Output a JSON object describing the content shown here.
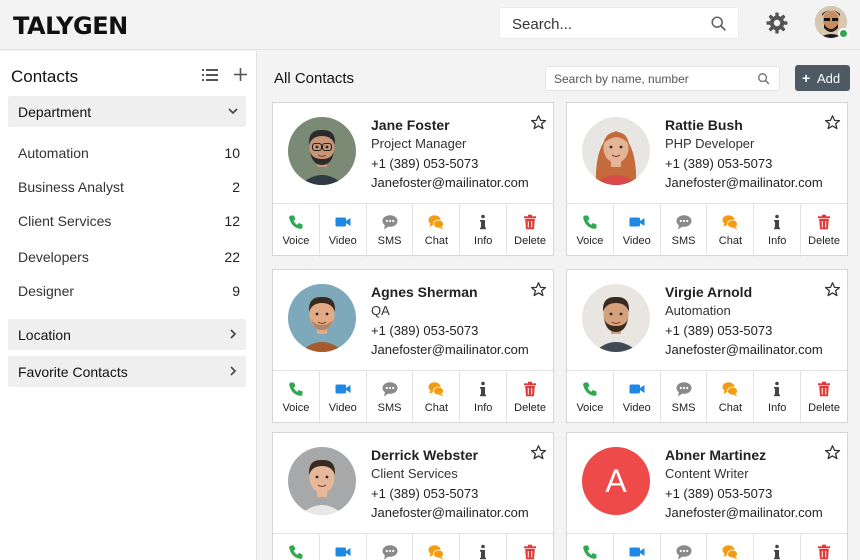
{
  "header": {
    "logo": "TALYGEN",
    "search_placeholder": "Search..."
  },
  "sidebar": {
    "title": "Contacts",
    "department_label": "Department",
    "departments": [
      {
        "label": "Automation",
        "count": "10"
      },
      {
        "label": "Business Analyst",
        "count": "2"
      },
      {
        "label": "Client Services",
        "count": "12"
      },
      {
        "label": "Developers",
        "count": "22"
      },
      {
        "label": "Designer",
        "count": "9"
      }
    ],
    "location_label": "Location",
    "favorites_label": "Favorite Contacts"
  },
  "main": {
    "title": "All Contacts",
    "search_placeholder": "Search by name, number",
    "add_label": "Add",
    "action_labels": [
      "Voice",
      "Video",
      "SMS",
      "Chat",
      "Info",
      "Delete"
    ],
    "contacts": [
      {
        "name": "Jane Foster",
        "role": "Project Manager",
        "phone": "+1 (389) 053-5073",
        "email": "Janefoster@mailinator.com"
      },
      {
        "name": "Rattie Bush",
        "role": "PHP Developer",
        "phone": "+1 (389) 053-5073",
        "email": "Janefoster@mailinator.com"
      },
      {
        "name": "Agnes Sherman",
        "role": "QA",
        "phone": "+1 (389) 053-5073",
        "email": "Janefoster@mailinator.com"
      },
      {
        "name": "Virgie Arnold",
        "role": "Automation",
        "phone": "+1 (389) 053-5073",
        "email": "Janefoster@mailinator.com"
      },
      {
        "name": "Derrick Webster",
        "role": "Client Services",
        "phone": "+1 (389) 053-5073",
        "email": "Janefoster@mailinator.com"
      },
      {
        "name": "Abner Martinez",
        "role": "Content Writer",
        "phone": "+1 (389) 053-5073",
        "email": "Janefoster@mailinator.com",
        "initial": "A"
      }
    ]
  },
  "colors": {
    "voice": "#2fa84f",
    "video": "#1e88e5",
    "sms": "#8a8a8a",
    "chat": "#f39c12",
    "info": "#444444",
    "delete": "#e53935",
    "add_button": "#4d5a64",
    "initial_avatar": "#ee4a4a"
  }
}
